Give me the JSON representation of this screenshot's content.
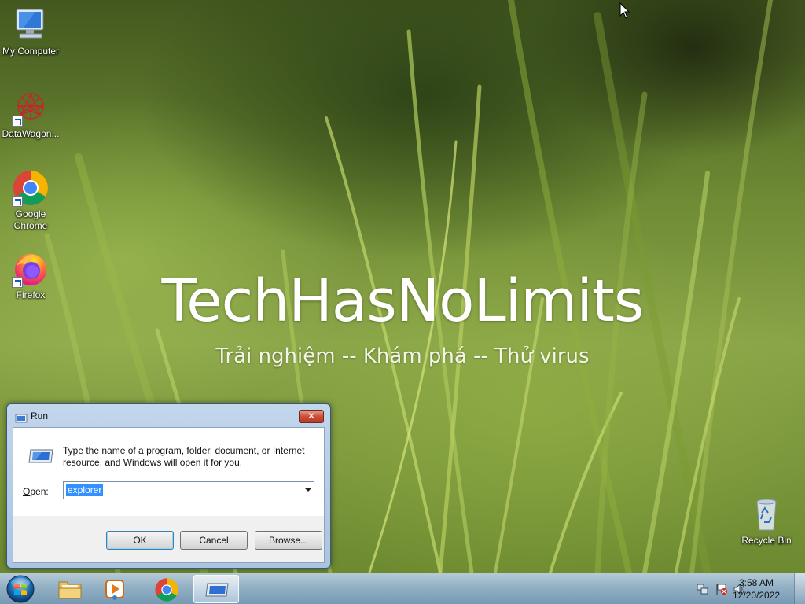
{
  "wallpaper": {
    "title": "TechHasNoLimits",
    "subtitle": "Trải nghiệm -- Khám phá -- Thử virus"
  },
  "desktop_icons": [
    {
      "label": "My Computer",
      "icon": "computer-icon"
    },
    {
      "label": "DataWagon...",
      "icon": "datawagon-icon"
    },
    {
      "label": "Google Chrome",
      "icon": "chrome-icon"
    },
    {
      "label": "Firefox",
      "icon": "firefox-icon"
    },
    {
      "label": "Recycle Bin",
      "icon": "recycle-bin-icon"
    }
  ],
  "run_dialog": {
    "title": "Run",
    "close_glyph": "✕",
    "description": "Type the name of a program, folder, document, or Internet resource, and Windows will open it for you.",
    "open_label": "Open:",
    "open_value": "explorer",
    "buttons": {
      "ok": "OK",
      "cancel": "Cancel",
      "browse": "Browse..."
    }
  },
  "taskbar": {
    "pinned": [
      {
        "name": "Windows Explorer",
        "icon": "folder-icon"
      },
      {
        "name": "Windows Media Player",
        "icon": "media-player-icon"
      },
      {
        "name": "Google Chrome",
        "icon": "chrome-icon"
      },
      {
        "name": "Run",
        "icon": "run-icon",
        "active": true
      }
    ],
    "clock": {
      "time": "3:58 AM",
      "date": "12/20/2022"
    }
  },
  "colors": {
    "accent_taskbar": "#9bb5cf",
    "selection": "#3390ff",
    "close_button": "#cf4f36"
  }
}
